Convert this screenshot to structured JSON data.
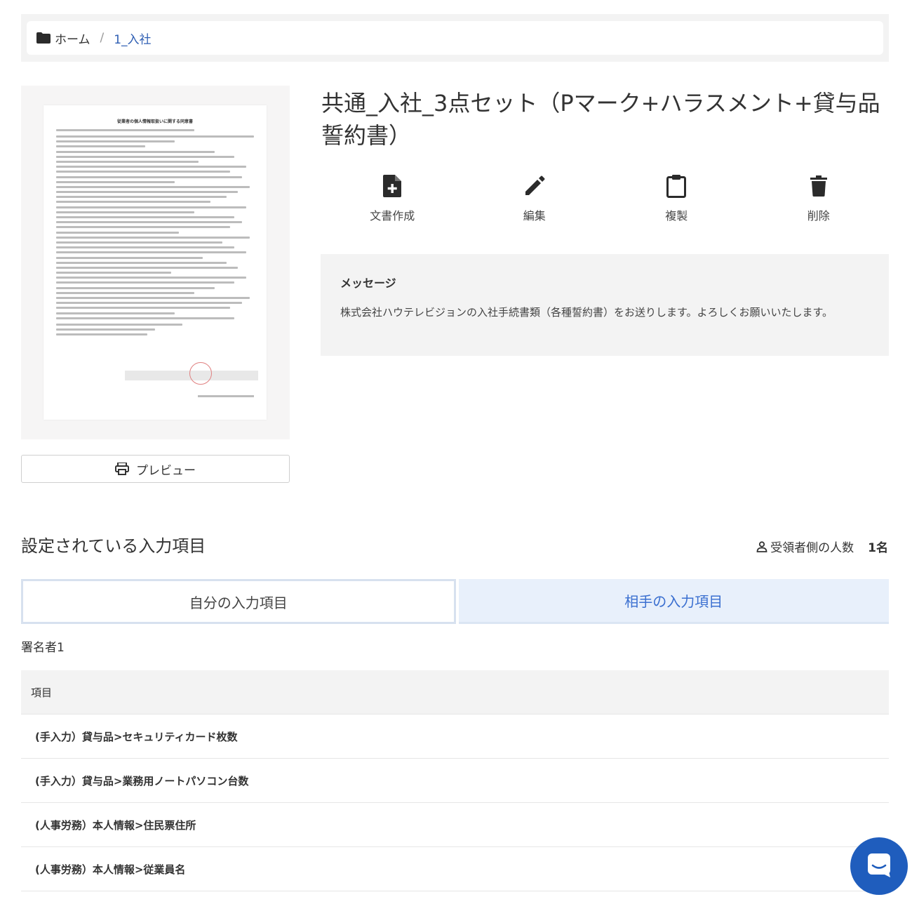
{
  "breadcrumb": {
    "home": "ホーム",
    "separator": "/",
    "current": "1_入社"
  },
  "document": {
    "title": "共通_入社_3点セット（Pマーク+ハラスメント+貸与品誓約書）",
    "thumbnail_heading": "従業者の個人情報取扱いに関する同意書"
  },
  "preview_button": "プレビュー",
  "actions": [
    {
      "label": "文書作成",
      "icon": "file-plus-icon"
    },
    {
      "label": "編集",
      "icon": "pencil-icon"
    },
    {
      "label": "複製",
      "icon": "clipboard-icon"
    },
    {
      "label": "削除",
      "icon": "trash-icon"
    }
  ],
  "message": {
    "title": "メッセージ",
    "body": "株式会社ハウテレビジョンの入社手続書類（各種誓約書）をお送りします。よろしくお願いいたします。"
  },
  "fields_section": {
    "title": "設定されている入力項目",
    "recipient_label": "受領者側の人数",
    "recipient_count": "1名"
  },
  "tabs": {
    "mine": "自分の入力項目",
    "partner": "相手の入力項目"
  },
  "signer": "署名者1",
  "items_table": {
    "header": "項目",
    "rows": [
      "(手入力）貸与品>セキュリティカード枚数",
      "(手入力）貸与品>業務用ノートパソコン台数",
      "(人事労務）本人情報>住民票住所",
      "(人事労務）本人情報>従業員名"
    ]
  },
  "colors": {
    "accent": "#2f5fb3",
    "tab_partner_bg": "#e8f0fb",
    "chat_button": "#1f5dbd"
  }
}
